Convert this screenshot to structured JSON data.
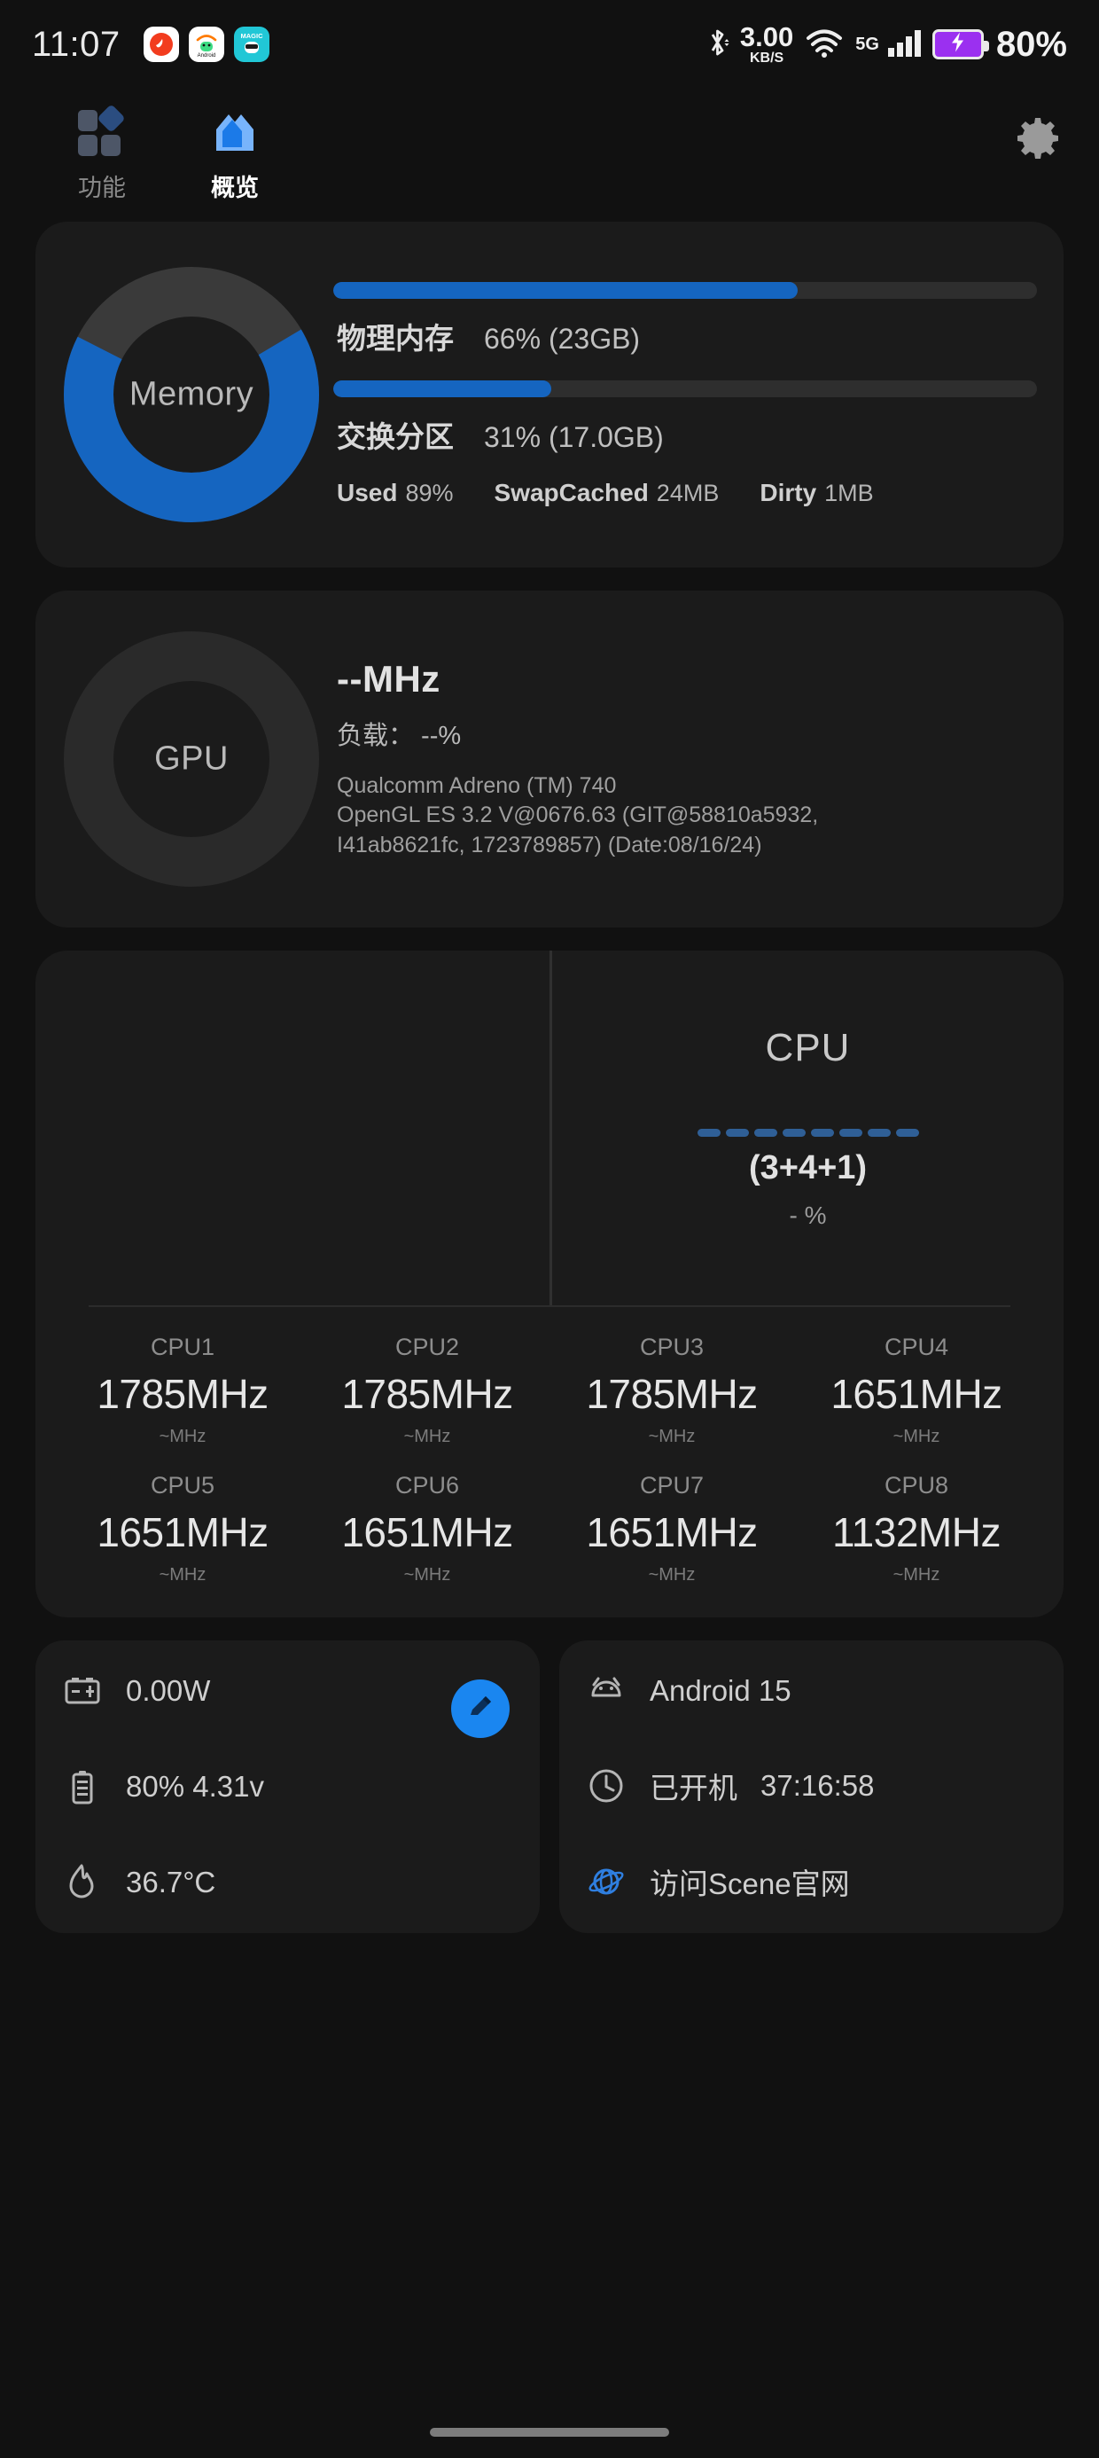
{
  "statusbar": {
    "time": "11:07",
    "network_speed_value": "3.00",
    "network_speed_unit": "KB/S",
    "mobile_label": "5G",
    "battery_percent": "80%",
    "icons": [
      "bluetooth-icon",
      "wifi-icon",
      "signal-icon",
      "battery-charging-icon"
    ]
  },
  "tabs": [
    {
      "label": "功能",
      "icon": "grid-diamond-icon",
      "active": false
    },
    {
      "label": "概览",
      "icon": "house-icon",
      "active": true
    }
  ],
  "settings_icon": "gear-icon",
  "memory": {
    "ring_label": "Memory",
    "ring_percent": 66,
    "bars": [
      {
        "name": "物理内存",
        "value": "66% (23GB)",
        "percent": 66
      },
      {
        "name": "交换分区",
        "value": "31% (17.0GB)",
        "percent": 31
      }
    ],
    "stats": [
      {
        "key": "Used",
        "value": "89%"
      },
      {
        "key": "SwapCached",
        "value": "24MB"
      },
      {
        "key": "Dirty",
        "value": "1MB"
      }
    ]
  },
  "gpu": {
    "ring_label": "GPU",
    "frequency": "--MHz",
    "load": "负载：  --%",
    "desc_line1": "Qualcomm Adreno (TM) 740",
    "desc_line2": "OpenGL ES 3.2 V@0676.63 (GIT@58810a5932,",
    "desc_line3": "I41ab8621fc, 1723789857) (Date:08/16/24)"
  },
  "cpu": {
    "title": "CPU",
    "cluster": "(3+4+1)",
    "load_percent": "- %",
    "dash_count": 8,
    "cores": [
      {
        "name": "CPU1",
        "freq": "1785MHz",
        "sub": "~MHz"
      },
      {
        "name": "CPU2",
        "freq": "1785MHz",
        "sub": "~MHz"
      },
      {
        "name": "CPU3",
        "freq": "1785MHz",
        "sub": "~MHz"
      },
      {
        "name": "CPU4",
        "freq": "1651MHz",
        "sub": "~MHz"
      },
      {
        "name": "CPU5",
        "freq": "1651MHz",
        "sub": "~MHz"
      },
      {
        "name": "CPU6",
        "freq": "1651MHz",
        "sub": "~MHz"
      },
      {
        "name": "CPU7",
        "freq": "1651MHz",
        "sub": "~MHz"
      },
      {
        "name": "CPU8",
        "freq": "1132MHz",
        "sub": "~MHz"
      }
    ]
  },
  "power_card": {
    "wattage": "0.00W",
    "battery": "80%  4.31v",
    "temperature": "36.7°C",
    "edit_icon": "pencil-icon",
    "icons": [
      "power-meter-icon",
      "battery-level-icon",
      "flame-icon"
    ]
  },
  "system_card": {
    "os": "Android 15",
    "uptime_label": "已开机",
    "uptime_value": "37:16:58",
    "link": "访问Scene官网",
    "icons": [
      "android-icon",
      "clock-icon",
      "globe-icon"
    ]
  },
  "colors": {
    "accent_blue": "#1565c0",
    "fab_blue": "#1a86f0",
    "card_bg": "#1b1b1b",
    "page_bg": "#111111"
  }
}
